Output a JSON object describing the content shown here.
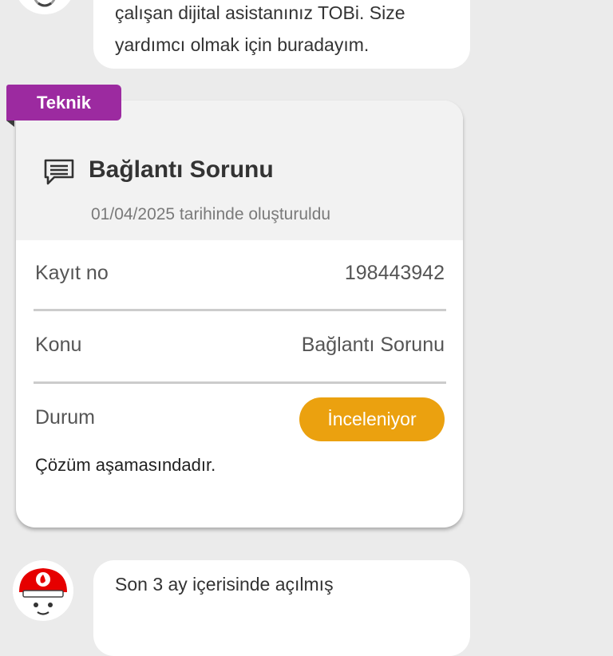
{
  "chat": {
    "top_message": {
      "line1": "çalışan dijital asistanınız TOBi. Size",
      "line2": "yardımcı olmak için buradayım."
    },
    "bottom_message": {
      "line1": "Son 3 ay içerisinde açılmış"
    }
  },
  "ticket": {
    "category_tag": "Teknik",
    "title": "Bağlantı Sorunu",
    "created": "01/04/2025 tarihinde oluşturuldu",
    "rows": {
      "record": {
        "label": "Kayıt no",
        "value": "198443942"
      },
      "subject": {
        "label": "Konu",
        "value": "Bağlantı Sorunu"
      },
      "status": {
        "label": "Durum",
        "value": "İnceleniyor"
      }
    },
    "status_note": "Çözüm aşamasındadır."
  },
  "colors": {
    "tag": "#9c2aa0",
    "status_pill": "#eba10f",
    "background": "#ebebeb",
    "brand_red": "#e60000"
  },
  "icons": {
    "ticket_title": "chat-bubble-icon",
    "assistant": "tobi-avatar-icon"
  }
}
